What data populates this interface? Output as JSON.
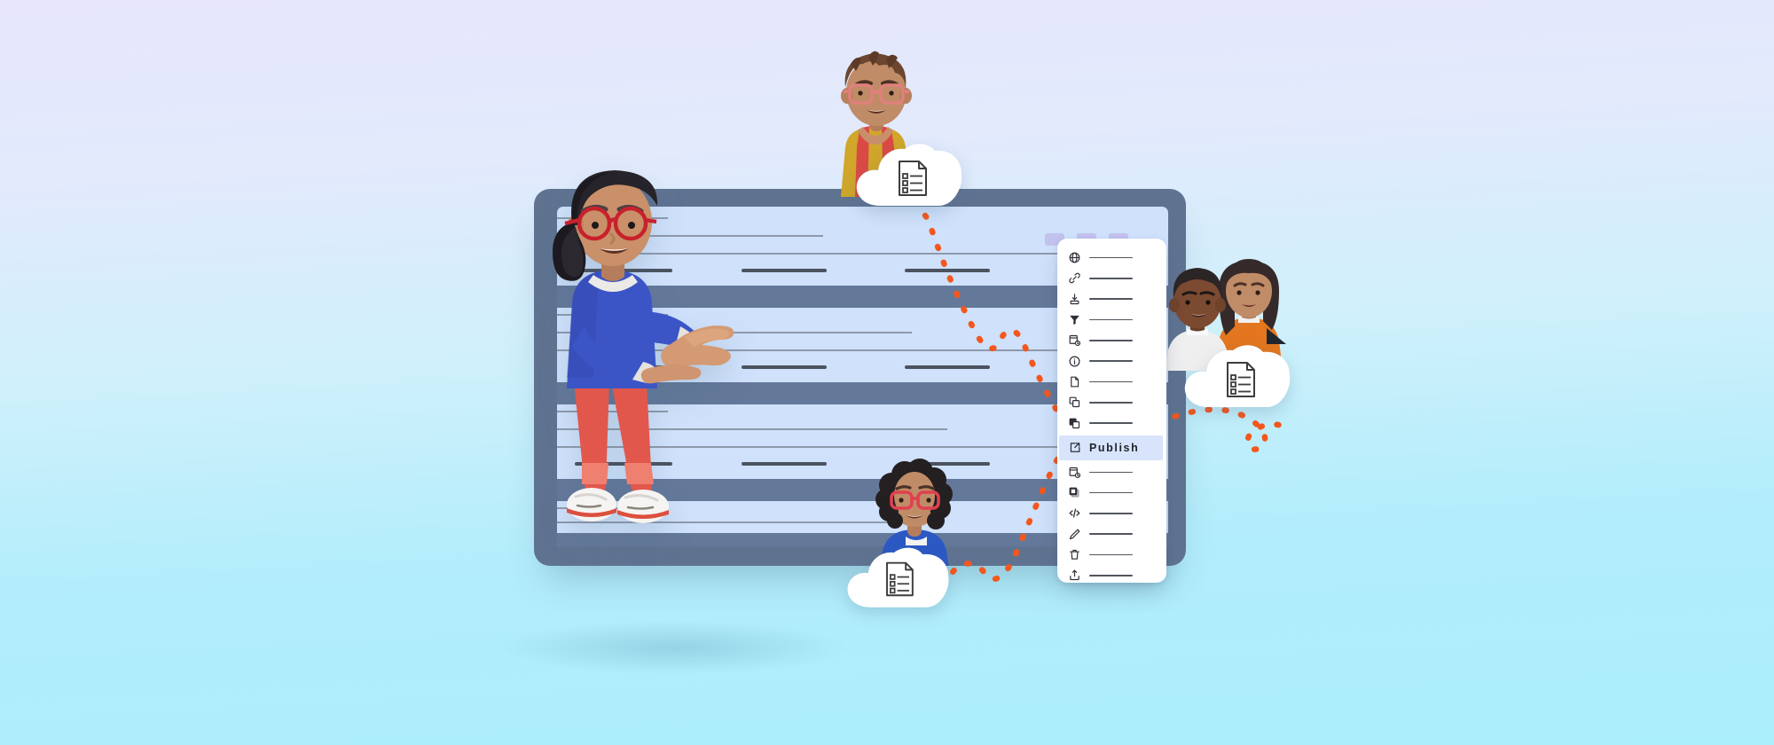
{
  "scene": {
    "title": "Document publishing collaboration illustration",
    "background": {
      "top_color": "#e7e6fc",
      "bottom_color": "#abeefc"
    },
    "accent_color": "#f4571d"
  },
  "document_window": {
    "name": "document-preview",
    "frame_color": "#5f7391",
    "page_color": "#cfe1fb",
    "band_color": "#64789a",
    "tabs": [
      {
        "name": "tab-1",
        "color": "#c2c2ee"
      },
      {
        "name": "tab-2",
        "color": "#c2c2ee"
      },
      {
        "name": "tab-3",
        "color": "#c2c2ee"
      }
    ]
  },
  "context_menu": {
    "name": "document-actions-menu",
    "background": "#ffffff",
    "highlight_color": "#d7e4fb",
    "items": [
      {
        "icon": "globe-icon",
        "label": ""
      },
      {
        "icon": "link-icon",
        "label": ""
      },
      {
        "icon": "import-icon",
        "label": ""
      },
      {
        "icon": "filter-icon",
        "label": ""
      },
      {
        "icon": "schedule-icon",
        "label": ""
      },
      {
        "icon": "info-icon",
        "label": ""
      },
      {
        "icon": "file-export-icon",
        "label": ""
      },
      {
        "icon": "copy-icon",
        "label": ""
      },
      {
        "icon": "duplicate-icon",
        "label": ""
      },
      {
        "icon": "publish-icon",
        "label": "Publish",
        "selected": true
      },
      {
        "icon": "schedule-icon",
        "label": ""
      },
      {
        "icon": "window-icon",
        "label": ""
      },
      {
        "icon": "code-icon",
        "label": ""
      },
      {
        "icon": "pencil-icon",
        "label": ""
      },
      {
        "icon": "trash-icon",
        "label": ""
      },
      {
        "icon": "upload-icon",
        "label": ""
      }
    ]
  },
  "characters": [
    {
      "name": "presenter-character",
      "description": "Woman with black ponytail, red glasses, blue top, red trousers, white sneakers, presenting with open hand",
      "colors": {
        "shirt": "#3b55c6",
        "pants": "#e2574c",
        "glasses": "#c8212c",
        "hair": "#26242a",
        "skin": "#c98f6b",
        "shoes": "#f3f2f0"
      }
    },
    {
      "name": "top-character",
      "description": "Man with brown spiky hair, pink glasses, red vest over yellow shirt",
      "colors": {
        "vest": "#d94a45",
        "shirt": "#d0a62b",
        "glasses": "#e0807c",
        "hair": "#6d4630",
        "skin": "#c08c67"
      }
    },
    {
      "name": "bottom-character",
      "description": "Woman with curly black hair, red glasses, blue shirt",
      "colors": {
        "shirt": "#2c58c4",
        "glasses": "#e0404f",
        "hair": "#241f21",
        "skin": "#c08c67"
      }
    },
    {
      "name": "right-character-a",
      "description": "Man with short dark hair, white shirt, dark skin",
      "colors": {
        "shirt": "#efefef",
        "hair": "#2c2526",
        "skin": "#7b4a31"
      }
    },
    {
      "name": "right-character-b",
      "description": "Woman with long dark hair, orange sweater",
      "colors": {
        "shirt": "#e3761e",
        "hair": "#35292a",
        "skin": "#c08c67"
      }
    }
  ],
  "cloud_bubbles": [
    {
      "name": "cloud-bubble-top",
      "icon": "document-list-icon"
    },
    {
      "name": "cloud-bubble-right",
      "icon": "document-list-icon"
    },
    {
      "name": "cloud-bubble-bottom",
      "icon": "document-list-icon"
    }
  ],
  "connector_paths": [
    {
      "name": "path-top-to-menu",
      "style": "dashed",
      "color": "#f4571d"
    },
    {
      "name": "path-menu-to-right",
      "style": "dashed",
      "color": "#f4571d"
    },
    {
      "name": "path-menu-to-bottom",
      "style": "dashed",
      "color": "#f4571d"
    }
  ]
}
